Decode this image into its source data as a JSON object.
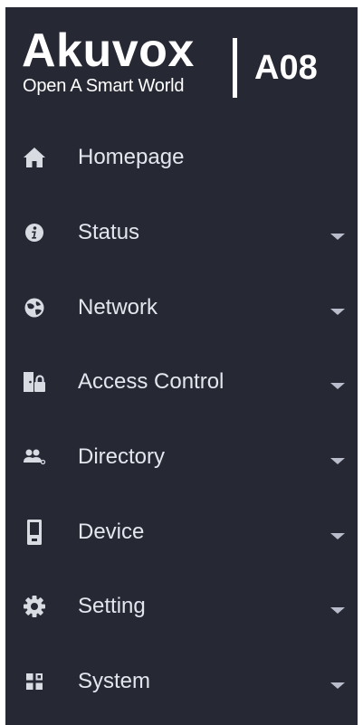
{
  "logo": {
    "brand": "Akuvox",
    "tagline": "Open A Smart World",
    "model": "A08"
  },
  "menu": [
    {
      "label": "Homepage",
      "icon": "home-icon",
      "has_submenu": false
    },
    {
      "label": "Status",
      "icon": "info-icon",
      "has_submenu": true
    },
    {
      "label": "Network",
      "icon": "globe-icon",
      "has_submenu": true
    },
    {
      "label": "Access Control",
      "icon": "door-lock-icon",
      "has_submenu": true
    },
    {
      "label": "Directory",
      "icon": "users-icon",
      "has_submenu": true
    },
    {
      "label": "Device",
      "icon": "device-icon",
      "has_submenu": true
    },
    {
      "label": "Setting",
      "icon": "gear-icon",
      "has_submenu": true
    },
    {
      "label": "System",
      "icon": "grid-icon",
      "has_submenu": true
    }
  ],
  "colors": {
    "sidebar_bg": "#262834",
    "text": "#e4e6ee",
    "icon": "#d9dbe3",
    "caret": "#b9bccb"
  }
}
